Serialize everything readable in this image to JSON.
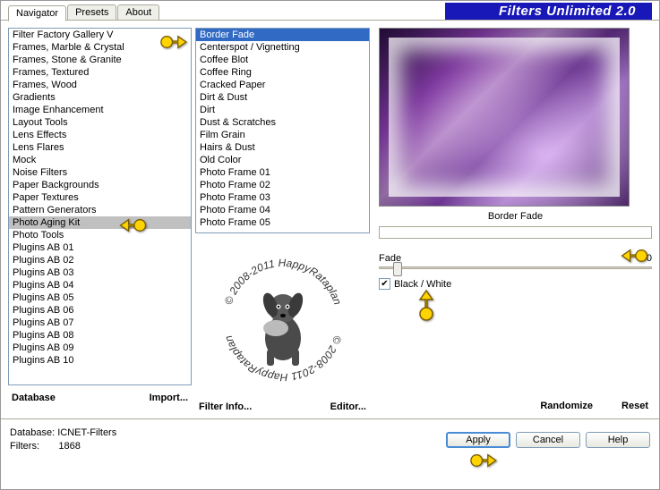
{
  "header": {
    "tabs": [
      "Navigator",
      "Presets",
      "About"
    ],
    "active_tab": 0,
    "title": "Filters Unlimited 2.0"
  },
  "categories": [
    "Filter Factory Gallery V",
    "Frames, Marble & Crystal",
    "Frames, Stone & Granite",
    "Frames, Textured",
    "Frames, Wood",
    "Gradients",
    "Image Enhancement",
    "Layout Tools",
    "Lens Effects",
    "Lens Flares",
    "Mock",
    "Noise Filters",
    "Paper Backgrounds",
    "Paper Textures",
    "Pattern Generators",
    "Photo Aging Kit",
    "Photo Tools",
    "Plugins AB 01",
    "Plugins AB 02",
    "Plugins AB 03",
    "Plugins AB 04",
    "Plugins AB 05",
    "Plugins AB 06",
    "Plugins AB 07",
    "Plugins AB 08",
    "Plugins AB 09",
    "Plugins AB 10"
  ],
  "categories_selected_index": 15,
  "filters": [
    "Border Fade",
    "Centerspot / Vignetting",
    "Coffee Blot",
    "Coffee Ring",
    "Cracked Paper",
    "Dirt & Dust",
    "Dirt",
    "Dust & Scratches",
    "Film Grain",
    "Hairs & Dust",
    "Old Color",
    "Photo Frame 01",
    "Photo Frame 02",
    "Photo Frame 03",
    "Photo Frame 04",
    "Photo Frame 05"
  ],
  "filters_selected_index": 0,
  "actions_left": {
    "database": "Database",
    "import": "Import...",
    "filter_info": "Filter Info...",
    "editor": "Editor..."
  },
  "actions_right": {
    "randomize": "Randomize",
    "reset": "Reset"
  },
  "preview": {
    "label": "Border Fade"
  },
  "params": {
    "fade_label": "Fade",
    "fade_value": "50",
    "fade_percent": 50,
    "bw_label": "Black / White",
    "bw_checked": true
  },
  "logo": {
    "ring_text_top": "© 2008-2011  HappyRataplan",
    "ring_text_bottom": "© 2008-2011  HappyRataplan"
  },
  "footer": {
    "db_label": "Database:",
    "db_value": "ICNET-Filters",
    "filters_label": "Filters:",
    "filters_value": "1868",
    "apply": "Apply",
    "cancel": "Cancel",
    "help": "Help"
  }
}
